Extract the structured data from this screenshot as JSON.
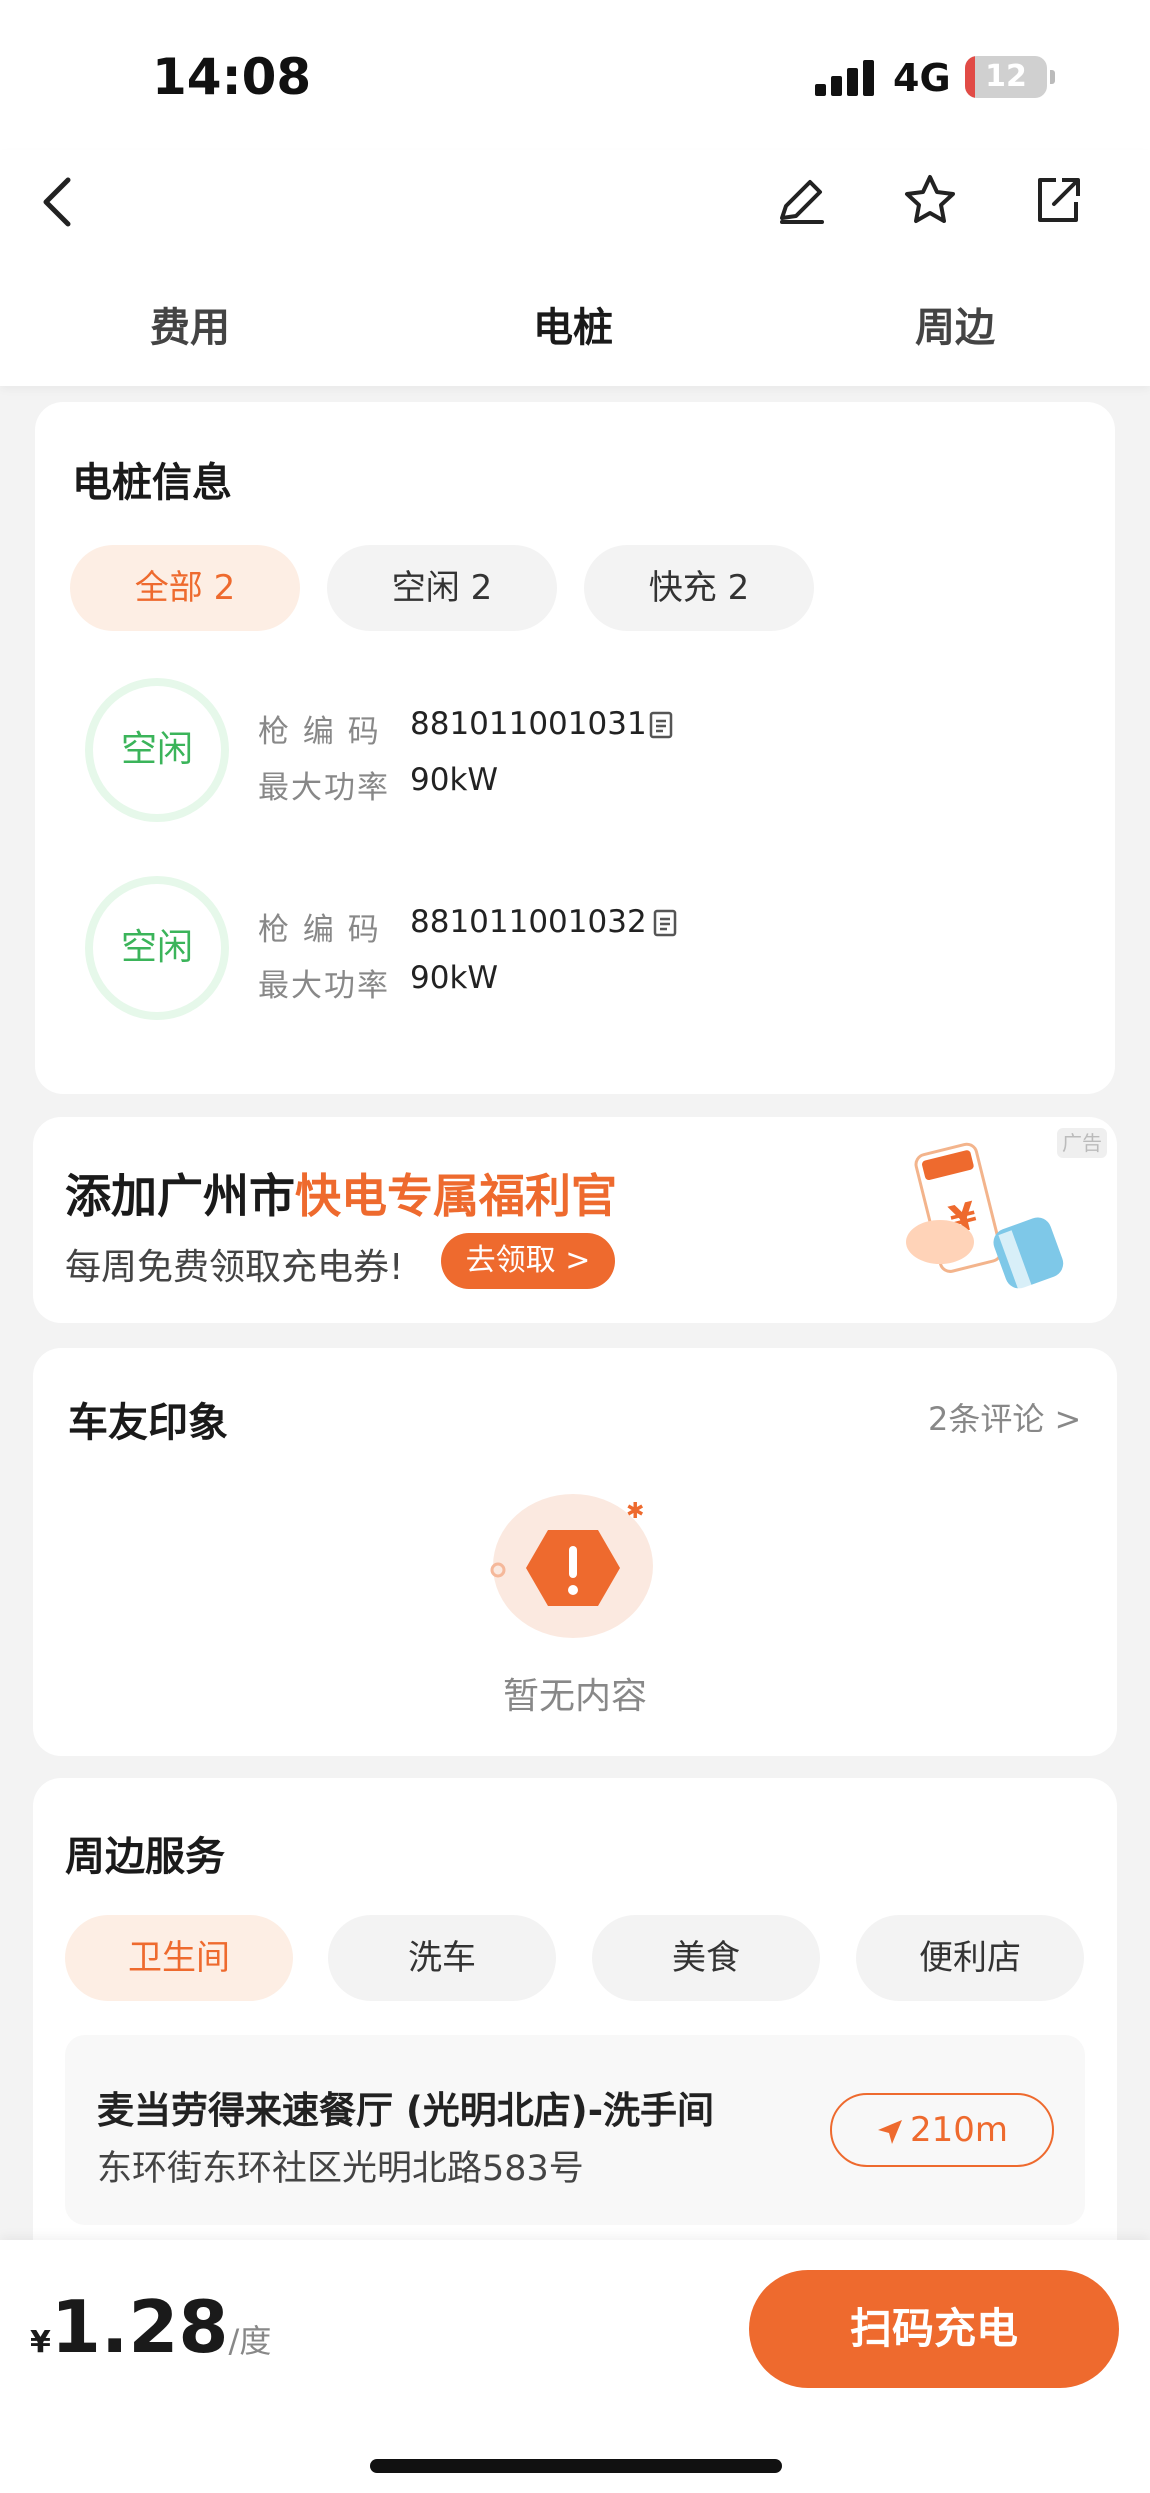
{
  "status_bar": {
    "time": "14:08",
    "network": "4G",
    "battery": "12"
  },
  "tabs": [
    "费用",
    "电桩",
    "周边"
  ],
  "pile_info": {
    "title": "电桩信息",
    "filters": [
      "全部 2",
      "空闲 2",
      "快充 2"
    ],
    "piles": [
      {
        "status": "空闲",
        "code_label": "枪 编 码",
        "code": "881011001031",
        "power_label": "最大功率",
        "power": "90kW"
      },
      {
        "status": "空闲",
        "code_label": "枪 编 码",
        "code": "881011001032",
        "power_label": "最大功率",
        "power": "90kW"
      }
    ]
  },
  "ad": {
    "title_plain": "添加广州市",
    "title_highlight": "快电专属福利官",
    "subtitle": "每周免费领取充电券!",
    "button": "去领取 >",
    "badge": "广告"
  },
  "reviews": {
    "title": "车友印象",
    "count_link": "2条评论 >",
    "empty_text": "暂无内容"
  },
  "nearby": {
    "title": "周边服务",
    "filters": [
      "卫生间",
      "洗车",
      "美食",
      "便利店"
    ],
    "items": [
      {
        "name": "麦当劳得来速餐厅 (光明北店)-洗手间",
        "address": "东环街东环社区光明北路583号",
        "distance": "210m"
      }
    ]
  },
  "bottom": {
    "currency": "¥",
    "price": "1.28",
    "unit": "/度",
    "scan_button": "扫码充电"
  },
  "colors": {
    "accent": "#ee6a2e",
    "free_green": "#3bb45a"
  }
}
